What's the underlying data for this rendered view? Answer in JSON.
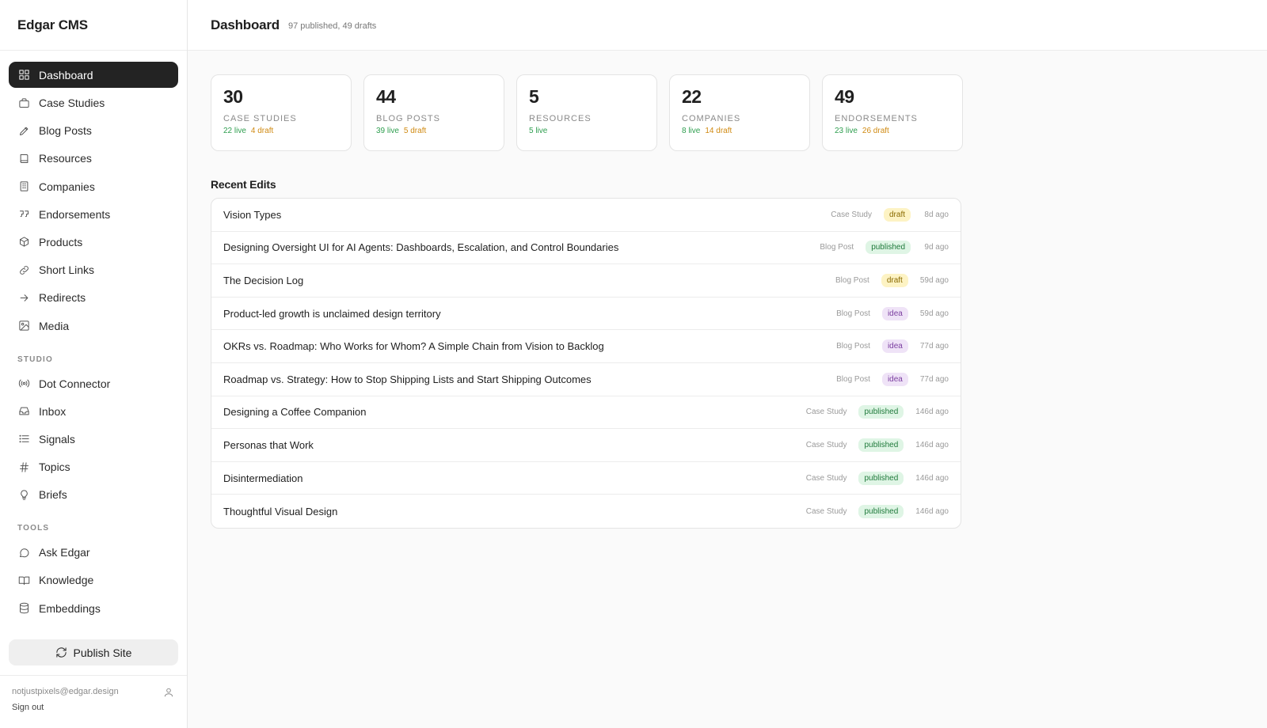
{
  "app": {
    "brand": "Edgar CMS"
  },
  "sidebar": {
    "main_items": [
      {
        "label": "Dashboard",
        "icon": "grid-icon"
      },
      {
        "label": "Case Studies",
        "icon": "briefcase-icon"
      },
      {
        "label": "Blog Posts",
        "icon": "pen-icon"
      },
      {
        "label": "Resources",
        "icon": "book-icon"
      },
      {
        "label": "Companies",
        "icon": "building-icon"
      },
      {
        "label": "Endorsements",
        "icon": "quote-icon"
      },
      {
        "label": "Products",
        "icon": "package-icon"
      },
      {
        "label": "Short Links",
        "icon": "link-icon"
      },
      {
        "label": "Redirects",
        "icon": "arrow-right-icon"
      },
      {
        "label": "Media",
        "icon": "image-icon"
      }
    ],
    "studio_label": "STUDIO",
    "studio_items": [
      {
        "label": "Dot Connector",
        "icon": "broadcast-icon"
      },
      {
        "label": "Inbox",
        "icon": "inbox-icon"
      },
      {
        "label": "Signals",
        "icon": "list-icon"
      },
      {
        "label": "Topics",
        "icon": "hash-icon"
      },
      {
        "label": "Briefs",
        "icon": "lightbulb-icon"
      }
    ],
    "tools_label": "TOOLS",
    "tools_items": [
      {
        "label": "Ask Edgar",
        "icon": "chat-icon"
      },
      {
        "label": "Knowledge",
        "icon": "open-book-icon"
      },
      {
        "label": "Embeddings",
        "icon": "database-icon"
      }
    ],
    "publish_label": "Publish Site",
    "user_email": "notjustpixels@edgar.design",
    "signout_label": "Sign out"
  },
  "header": {
    "title": "Dashboard",
    "subtitle": "97 published, 49 drafts"
  },
  "stats": [
    {
      "value": "30",
      "label": "CASE STUDIES",
      "live": "22 live",
      "draft": "4 draft"
    },
    {
      "value": "44",
      "label": "BLOG POSTS",
      "live": "39 live",
      "draft": "5 draft"
    },
    {
      "value": "5",
      "label": "RESOURCES",
      "live": "5 live",
      "draft": ""
    },
    {
      "value": "22",
      "label": "COMPANIES",
      "live": "8 live",
      "draft": "14 draft"
    },
    {
      "value": "49",
      "label": "ENDORSEMENTS",
      "live": "23 live",
      "draft": "26 draft"
    }
  ],
  "recent": {
    "title": "Recent Edits",
    "rows": [
      {
        "title": "Vision Types",
        "type": "Case Study",
        "status": "draft",
        "time": "8d ago"
      },
      {
        "title": "Designing Oversight UI for AI Agents: Dashboards, Escalation, and Control Boundaries",
        "type": "Blog Post",
        "status": "published",
        "time": "9d ago"
      },
      {
        "title": "The Decision Log",
        "type": "Blog Post",
        "status": "draft",
        "time": "59d ago"
      },
      {
        "title": "Product-led growth is unclaimed design territory",
        "type": "Blog Post",
        "status": "idea",
        "time": "59d ago"
      },
      {
        "title": "OKRs vs. Roadmap: Who Works for Whom? A Simple Chain from Vision to Backlog",
        "type": "Blog Post",
        "status": "idea",
        "time": "77d ago"
      },
      {
        "title": "Roadmap vs. Strategy: How to Stop Shipping Lists and Start Shipping Outcomes",
        "type": "Blog Post",
        "status": "idea",
        "time": "77d ago"
      },
      {
        "title": "Designing a Coffee Companion",
        "type": "Case Study",
        "status": "published",
        "time": "146d ago"
      },
      {
        "title": "Personas that Work",
        "type": "Case Study",
        "status": "published",
        "time": "146d ago"
      },
      {
        "title": "Disintermediation",
        "type": "Case Study",
        "status": "published",
        "time": "146d ago"
      },
      {
        "title": "Thoughtful Visual Design",
        "type": "Case Study",
        "status": "published",
        "time": "146d ago"
      }
    ]
  },
  "colors": {
    "active_nav_bg": "#232323",
    "live": "#2e9e4f",
    "draft": "#d08a12",
    "badge_draft_bg": "#fdf3c4",
    "badge_published_bg": "#dff5e5",
    "badge_idea_bg": "#efe3f7"
  }
}
